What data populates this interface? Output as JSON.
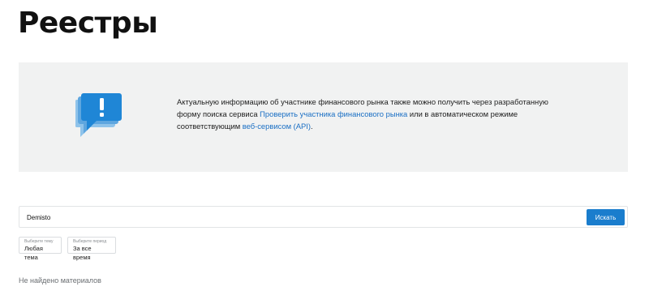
{
  "page": {
    "title": "Реестры"
  },
  "info": {
    "text_before": "Актуальную информацию об участнике финансового рынка также можно получить через разработанную форму поиска сервиса ",
    "link_check_participant": "Проверить участника финансового рынка",
    "text_middle": " или в автоматическом режиме соответствующим ",
    "link_web_service": "веб-сервисом (API)",
    "text_after": ".",
    "icon": "exclamation-speech-bubble-icon",
    "icon_colors": {
      "front": "#1f86d6",
      "back": "#8fc3ea",
      "mark": "#ffffff"
    }
  },
  "search": {
    "value": "Demisto",
    "button_label": "Искать"
  },
  "filters": {
    "theme": {
      "caption": "Выберите тему",
      "value": "Любая тема"
    },
    "period": {
      "caption": "Выберите период",
      "value": "За все время"
    }
  },
  "results": {
    "empty_message": "Не найдено материалов"
  },
  "colors": {
    "accent": "#1a7dcd",
    "link": "#1a6fc4",
    "panel_bg": "#f1f2f2"
  }
}
